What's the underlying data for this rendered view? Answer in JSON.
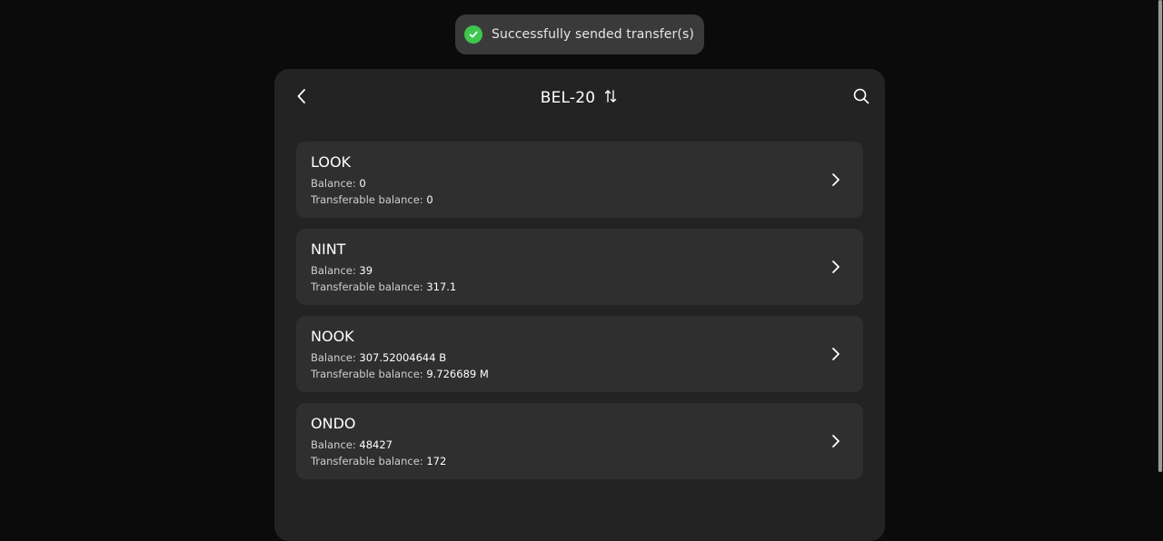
{
  "toast": {
    "icon": "check-circle-icon",
    "message": "Successfully sended transfer(s)",
    "color": "#3ec64f"
  },
  "header": {
    "title": "BEL-20",
    "back_icon": "chevron-left-icon",
    "sort_icon": "sort-arrows-icon",
    "search_icon": "search-icon"
  },
  "labels": {
    "balance": "Balance: ",
    "transferable": "Transferable balance: "
  },
  "tokens": [
    {
      "name": "LOOK",
      "balance": "0",
      "transferable": "0"
    },
    {
      "name": "NINT",
      "balance": "39",
      "transferable": "317.1"
    },
    {
      "name": "NOOK",
      "balance": "307.52004644 B",
      "transferable": "9.726689 M"
    },
    {
      "name": "ONDO",
      "balance": "48427",
      "transferable": "172"
    }
  ],
  "colors": {
    "background": "#0b0b0b",
    "panel": "#232323",
    "card": "#2f2f2f",
    "toast": "#3a3a3a"
  }
}
